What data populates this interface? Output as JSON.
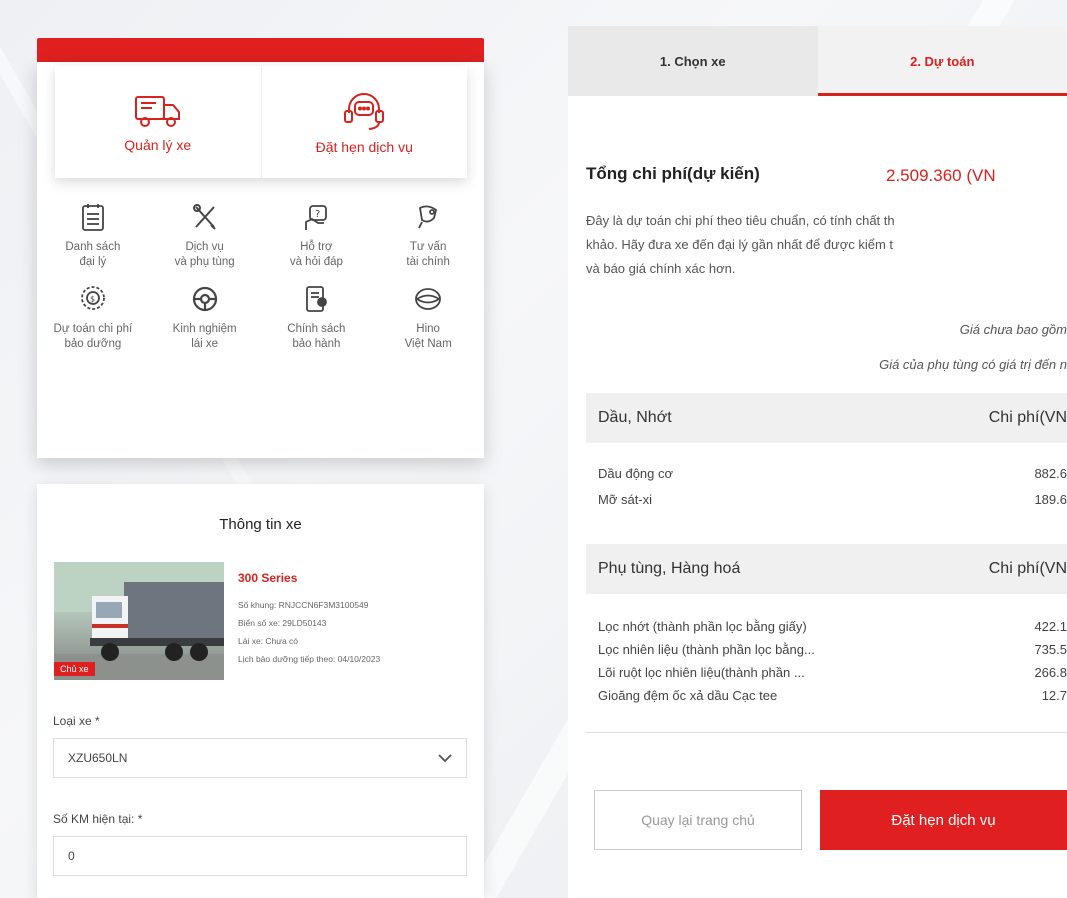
{
  "menu": {
    "top_tabs": [
      {
        "label": "Quản lý xe",
        "icon": "truck-icon"
      },
      {
        "label": "Đặt hẹn dịch vụ",
        "icon": "headset-chat-icon"
      }
    ],
    "grid": [
      {
        "line1": "Danh sách",
        "line2": "đại lý",
        "icon": "list-icon"
      },
      {
        "line1": "Dịch vụ",
        "line2": "và phụ tùng",
        "icon": "tools-icon"
      },
      {
        "line1": "Hỗ trợ",
        "line2": "và hỏi đáp",
        "icon": "support-icon"
      },
      {
        "line1": "Tư vấn",
        "line2": "tài chính",
        "icon": "finance-hand-icon"
      },
      {
        "line1": "Dự toán chi phí",
        "line2": "bảo dưỡng",
        "icon": "cost-estimate-icon"
      },
      {
        "line1": "Kinh nghiệm",
        "line2": "lái xe",
        "icon": "steering-wheel-icon"
      },
      {
        "line1": "Chính sách",
        "line2": "bảo hành",
        "icon": "warranty-policy-icon"
      },
      {
        "line1": "Hino",
        "line2": "Việt Nam",
        "icon": "hino-logo-icon"
      }
    ]
  },
  "vehicle": {
    "title": "Thông tin xe",
    "badge": "Chủ xe",
    "name": "300 Series",
    "chassis": "Số khung: RNJCCN6F3M3100549",
    "plate": "Biển số xe: 29LD50143",
    "driver": "Lái xe: Chưa có",
    "next_service": "Lịch bảo dưỡng tiếp theo: 04/10/2023",
    "type_label": "Loại xe *",
    "type_value": "XZU650LN",
    "km_label": "Số KM hiện tại: *",
    "km_value": "0"
  },
  "estimate": {
    "steps": [
      "1. Chọn xe",
      "2. Dự toán"
    ],
    "total_label": "Tổng chi phí(dự kiến)",
    "total_value": "2.509.360 (VN",
    "desc_lines": [
      "Đây là dự toán chi phí theo tiêu chuẩn, có tính chất th",
      "khảo. Hãy đưa xe đến đại lý gần nhất để được kiểm t",
      "và báo giá chính xác hơn."
    ],
    "note1": "Giá chưa bao gồm",
    "note2": "Giá của phụ tùng có giá trị đến n",
    "oil": {
      "header": "Dầu, Nhớt",
      "cost_header": "Chi phí(VN",
      "rows": [
        {
          "name": "Dầu động cơ",
          "value": "882.6"
        },
        {
          "name": "Mỡ sát-xi",
          "value": "189.6"
        }
      ]
    },
    "parts": {
      "header": "Phụ tùng, Hàng hoá",
      "cost_header": "Chi phí(VN",
      "rows": [
        {
          "name": "Lọc nhớt (thành phần lọc bằng giấy)",
          "value": "422.1"
        },
        {
          "name": "Lọc nhiên liệu (thành phần lọc bằng...",
          "value": "735.5"
        },
        {
          "name": "Lõi ruột lọc nhiên liệu(thành phần ...",
          "value": "266.8"
        },
        {
          "name": "Gioăng đệm ốc xả dầu Cạc tee",
          "value": "12.7"
        }
      ]
    },
    "back_button": "Quay lại trang chủ",
    "book_button": "Đặt hẹn dịch vụ"
  },
  "colors": {
    "accent": "#d6231e",
    "red_button": "#e02020"
  }
}
